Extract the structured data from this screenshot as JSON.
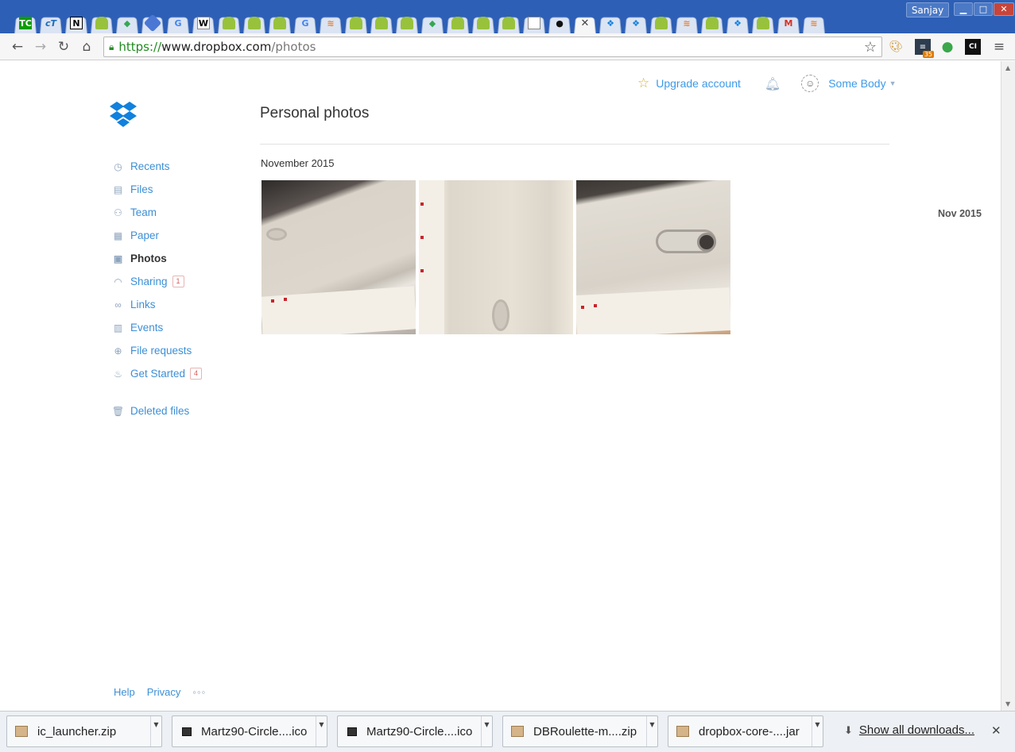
{
  "browser": {
    "user_name": "Sanjay",
    "window_controls": {
      "minimize": "▭",
      "maximize": "□",
      "close": "✕"
    },
    "tabs": [
      {
        "icon": "techcrunch-icon",
        "glyph": "TC",
        "kind": "tc"
      },
      {
        "icon": "ct-icon",
        "glyph": "cT",
        "kind": "ct"
      },
      {
        "icon": "n-icon",
        "glyph": "N",
        "kind": "n"
      },
      {
        "icon": "android-icon",
        "glyph": "",
        "kind": "android"
      },
      {
        "icon": "drive-icon",
        "glyph": "◆",
        "kind": "drive"
      },
      {
        "icon": "hexagon-icon",
        "glyph": "",
        "kind": "hex"
      },
      {
        "icon": "google-icon",
        "glyph": "G",
        "kind": "g"
      },
      {
        "icon": "wikipedia-icon",
        "glyph": "W",
        "kind": "w"
      },
      {
        "icon": "android-icon",
        "glyph": "",
        "kind": "android"
      },
      {
        "icon": "android-icon",
        "glyph": "",
        "kind": "android"
      },
      {
        "icon": "android-icon",
        "glyph": "",
        "kind": "android"
      },
      {
        "icon": "google-icon",
        "glyph": "G",
        "kind": "g"
      },
      {
        "icon": "stackoverflow-icon",
        "glyph": "≋",
        "kind": "so"
      },
      {
        "icon": "android-icon",
        "glyph": "",
        "kind": "android"
      },
      {
        "icon": "android-icon",
        "glyph": "",
        "kind": "android"
      },
      {
        "icon": "android-icon",
        "glyph": "",
        "kind": "android"
      },
      {
        "icon": "drive-icon",
        "glyph": "◆",
        "kind": "drive"
      },
      {
        "icon": "android-icon",
        "glyph": "",
        "kind": "android"
      },
      {
        "icon": "android-icon",
        "glyph": "",
        "kind": "android"
      },
      {
        "icon": "android-icon",
        "glyph": "",
        "kind": "android"
      },
      {
        "icon": "document-icon",
        "glyph": "",
        "kind": "doc"
      },
      {
        "icon": "github-icon",
        "glyph": "●",
        "kind": "gh"
      },
      {
        "icon": "close-icon",
        "glyph": "✕",
        "kind": "active"
      },
      {
        "icon": "dropbox-icon",
        "glyph": "❖",
        "kind": "db"
      },
      {
        "icon": "dropbox-icon",
        "glyph": "❖",
        "kind": "db"
      },
      {
        "icon": "android-icon",
        "glyph": "",
        "kind": "android"
      },
      {
        "icon": "stackoverflow-icon",
        "glyph": "≋",
        "kind": "so"
      },
      {
        "icon": "android-icon",
        "glyph": "",
        "kind": "android"
      },
      {
        "icon": "dropbox-icon",
        "glyph": "❖",
        "kind": "db"
      },
      {
        "icon": "android-icon",
        "glyph": "",
        "kind": "android"
      },
      {
        "icon": "gmail-icon",
        "glyph": "M",
        "kind": "m"
      },
      {
        "icon": "stackoverflow-icon",
        "glyph": "≋",
        "kind": "so"
      }
    ],
    "address": {
      "scheme": "https://",
      "host": "www.dropbox.com",
      "path": "/photos"
    },
    "extension_badge": "35"
  },
  "page": {
    "upgrade_label": "Upgrade account",
    "account_name": "Some Body",
    "title": "Personal photos",
    "month_heading": "November 2015",
    "timeline_label": "Nov 2015",
    "nav": [
      {
        "label": "Recents",
        "icon": "clock-icon",
        "glyph": "◷",
        "active": false,
        "badge": null
      },
      {
        "label": "Files",
        "icon": "file-icon",
        "glyph": "▤",
        "active": false,
        "badge": null
      },
      {
        "label": "Team",
        "icon": "team-icon",
        "glyph": "⚇",
        "active": false,
        "badge": null
      },
      {
        "label": "Paper",
        "icon": "paper-icon",
        "glyph": "▦",
        "active": false,
        "badge": null
      },
      {
        "label": "Photos",
        "icon": "photo-icon",
        "glyph": "▣",
        "active": true,
        "badge": null
      },
      {
        "label": "Sharing",
        "icon": "rainbow-icon",
        "glyph": "◠",
        "active": false,
        "badge": "1"
      },
      {
        "label": "Links",
        "icon": "link-icon",
        "glyph": "∞",
        "active": false,
        "badge": null
      },
      {
        "label": "Events",
        "icon": "calendar-icon",
        "glyph": "▥",
        "active": false,
        "badge": null
      },
      {
        "label": "File requests",
        "icon": "file-request-icon",
        "glyph": "⊕",
        "active": false,
        "badge": null
      },
      {
        "label": "Get Started",
        "icon": "cake-icon",
        "glyph": "♨",
        "active": false,
        "badge": "4"
      }
    ],
    "deleted_label": "Deleted files",
    "footer": {
      "help": "Help",
      "privacy": "Privacy",
      "more": "◦◦◦"
    }
  },
  "downloads": {
    "items": [
      {
        "name": "ic_launcher.zip",
        "type": "zip"
      },
      {
        "name": "Martz90-Circle....ico",
        "type": "ico"
      },
      {
        "name": "Martz90-Circle....ico",
        "type": "ico"
      },
      {
        "name": "DBRoulette-m....zip",
        "type": "zip"
      },
      {
        "name": "dropbox-core-....jar",
        "type": "zip"
      }
    ],
    "show_all": "Show all downloads..."
  },
  "colors": {
    "link_blue": "#3d8fd6",
    "dropbox_blue": "#1081de",
    "chrome_blue": "#2d5fb6"
  }
}
